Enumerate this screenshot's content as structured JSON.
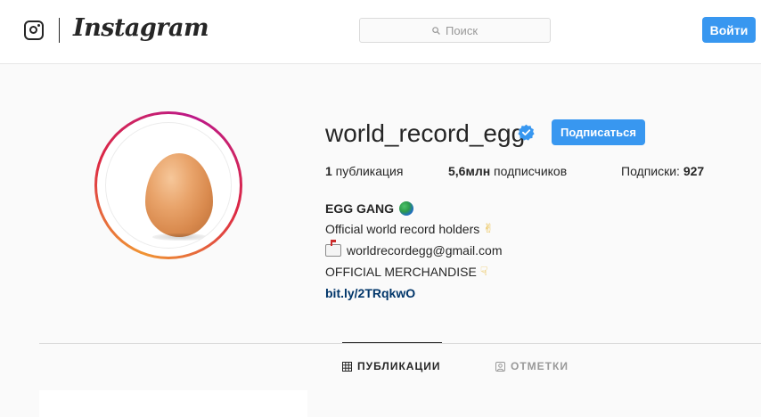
{
  "header": {
    "logo_icon": "instagram-camera-icon",
    "wordmark": "Instagram",
    "search": {
      "placeholder": "Поиск",
      "icon": "search-icon"
    },
    "login_label": "Войти",
    "accent_color": "#3897f0"
  },
  "profile": {
    "avatar_icon": "egg-photo",
    "username": "world_record_egg",
    "verified_icon": "verified-badge-icon",
    "follow_label": "Подписаться",
    "stats": {
      "posts_count": "1",
      "posts_label": " публикация",
      "followers_count": "5,6млн",
      "followers_label": " подписчиков",
      "following_label": "Подписки: ",
      "following_count": "927"
    },
    "bio": {
      "name": "EGG GANG",
      "line1": "Official world record holders",
      "line2": "worldrecordegg@gmail.com",
      "line3": "OFFICIAL MERCHANDISE",
      "link": "bit.ly/2TRqkwO"
    }
  },
  "tabs": [
    {
      "label": "ПУБЛИКАЦИИ",
      "icon": "grid-icon",
      "active": true
    },
    {
      "label": "ОТМЕТКИ",
      "icon": "tagged-user-icon",
      "active": false
    }
  ]
}
